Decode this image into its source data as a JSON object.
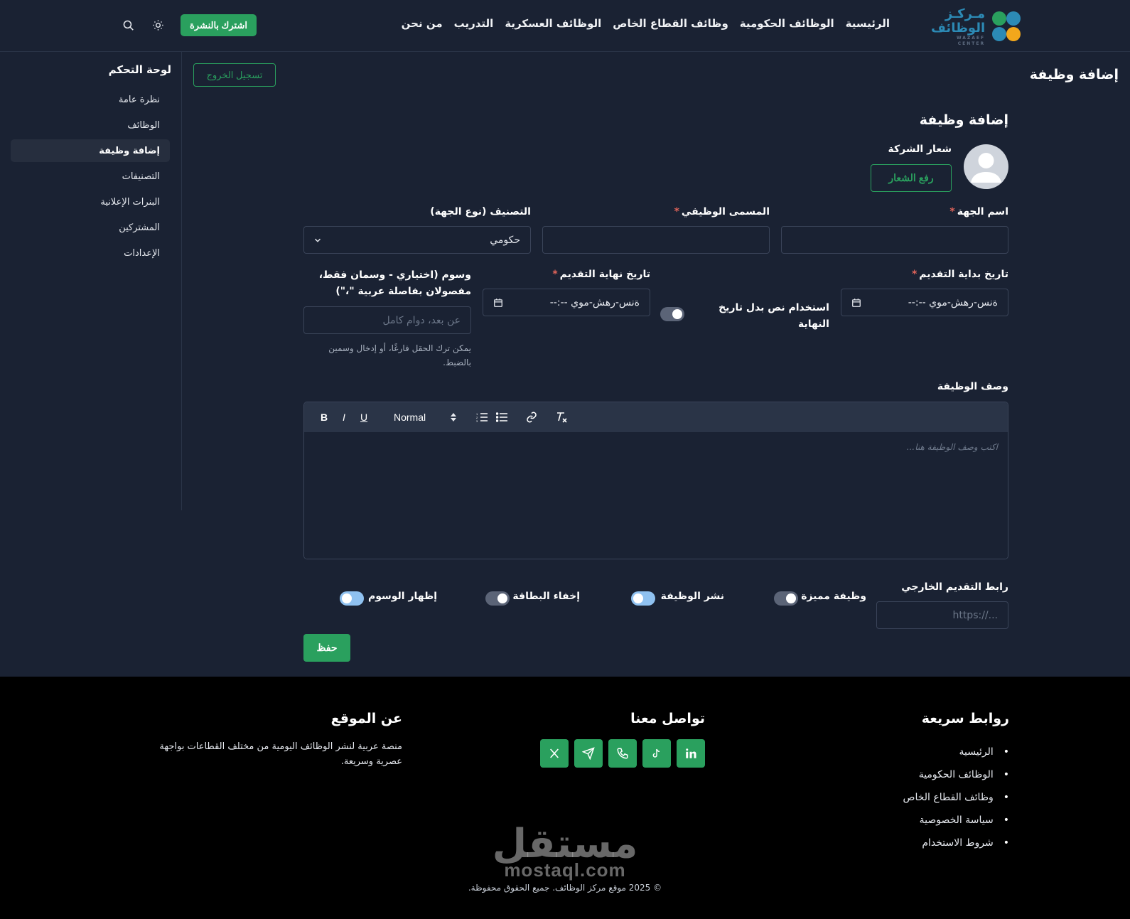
{
  "brand": {
    "line1": "مـركـز",
    "line2": "الوظائف",
    "sub": "WAZAEF CENTER"
  },
  "nav": {
    "links": [
      "الرئيسية",
      "الوظائف الحكومية",
      "وظائف القطاع الخاص",
      "الوظائف العسكرية",
      "التدريب",
      "من نحن"
    ],
    "subscribe": "اشترك بالنشرة"
  },
  "page_heading": "إضافة وظيفة",
  "sidebar": {
    "title": "لوحة التحكم",
    "items": [
      {
        "label": "نظرة عامة"
      },
      {
        "label": "الوظائف"
      },
      {
        "label": "إضافة وظيفة"
      },
      {
        "label": "التصنيفات"
      },
      {
        "label": "البنرات الإعلانية"
      },
      {
        "label": "المشتركين"
      },
      {
        "label": "الإعدادات"
      }
    ]
  },
  "logout": "تسجيل الخروج",
  "form": {
    "title": "إضافة وظيفة",
    "logo_label": "شعار الشركة",
    "upload": "رفع الشعار",
    "company_label": "اسم الجهة",
    "job_title_label": "المسمى الوظيفي",
    "category_label": "التصنيف (نوع الجهة)",
    "category_value": "حكومي",
    "start_label": "تاريخ بداية التقديم",
    "start_value": "ةنس-رهش-موي --:--",
    "use_text_label": "استخدام نص بدل تاريخ النهاية",
    "end_label": "تاريخ نهاية التقديم",
    "end_value": "ةنس-رهش-موي --:--",
    "tags_label": "وسوم (اختياري - وسمان فقط، مفصولان بفاصلة عربية \"،\")",
    "tags_placeholder": "عن بعد، دوام كامل",
    "tags_hint": "يمكن ترك الحقل فارغًا، أو إدخال وسمين بالضبط.",
    "desc_label": "وصف الوظيفة",
    "editor_format": "Normal",
    "desc_placeholder": "اكتب وصف الوظيفة هنا...",
    "apply_link_label": "رابط التقديم الخارجي",
    "apply_link_placeholder": "https://...",
    "featured_label": "وظيفة مميزة",
    "publish_label": "نشر الوظيفة",
    "hide_card_label": "إخفاء البطاقة",
    "show_tags_label": "إظهار الوسوم",
    "save": "حفظ",
    "toggles": {
      "use_text": false,
      "featured": false,
      "publish": true,
      "hide_card": false,
      "show_tags": true
    }
  },
  "footer": {
    "quick_links_title": "روابط سريعة",
    "quick_links": [
      "الرئيسية",
      "الوظائف الحكومية",
      "وظائف القطاع الخاص",
      "سياسة الخصوصية",
      "شروط الاستخدام"
    ],
    "contact_title": "تواصل معنا",
    "socials": [
      "x-icon",
      "telegram-icon",
      "phone-icon",
      "tiktok-icon",
      "linkedin-icon"
    ],
    "about_title": "عن الموقع",
    "about_text": "منصة عربية لنشر الوظائف اليومية من مختلف القطاعات بواجهة عصرية وسريعة.",
    "copyright": "© 2025 موقع مركز الوظائف. جميع الحقوق محفوظة.",
    "watermark_ar": "مستقل",
    "watermark_en": "mostaql.com"
  },
  "colors": {
    "accent": "#2aa05e",
    "bg": "#1a2233",
    "footer_bg": "#000000",
    "required": "#e0645a"
  }
}
